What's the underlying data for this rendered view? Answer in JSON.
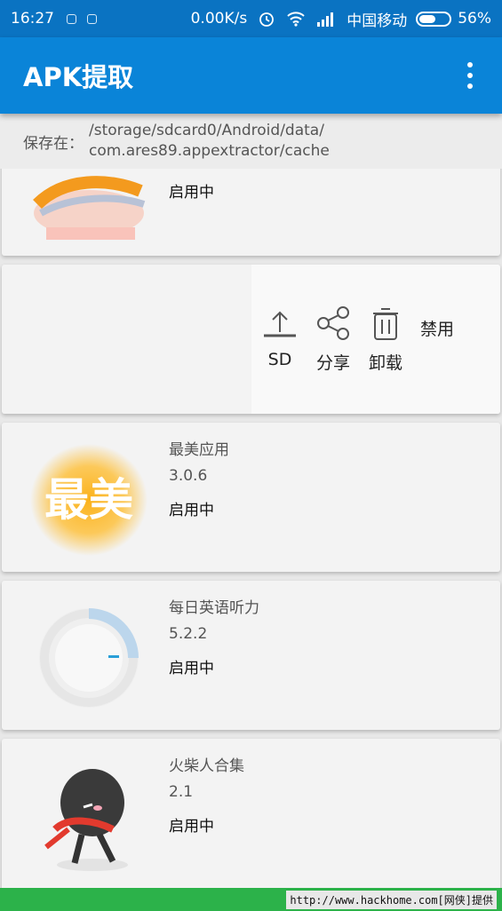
{
  "status_bar": {
    "time": "16:27",
    "network_speed": "0.00K/s",
    "carrier": "中国移动",
    "battery": "56%",
    "battery_level": 0.56
  },
  "app_bar": {
    "title": "APK提取"
  },
  "path_bar": {
    "label": "保存在：",
    "path_line1": "/storage/sdcard0/Android/data/",
    "path_line2": "com.ares89.appextractor/cache"
  },
  "apps": [
    {
      "name": "",
      "version": "",
      "state": "启用中",
      "icon": "red-envelope-icon"
    },
    {
      "name": "",
      "version": "",
      "state": "",
      "icon": ""
    },
    {
      "name": "最美应用",
      "version": "3.0.6",
      "state": "启用中",
      "icon": "zuimei-icon"
    },
    {
      "name": "每日英语听力",
      "version": "5.2.2",
      "state": "启用中",
      "icon": "english-listening-icon"
    },
    {
      "name": "火柴人合集",
      "version": "2.1",
      "state": "启用中",
      "icon": "stickman-icon"
    }
  ],
  "swipe_actions": [
    {
      "label": "SD",
      "icon": "upload-icon"
    },
    {
      "label": "分享",
      "icon": "share-icon"
    },
    {
      "label": "卸载",
      "icon": "trash-icon"
    },
    {
      "label": "禁用",
      "icon": ""
    }
  ],
  "watermark": "http://www.hackhome.com[网侠]提供"
}
